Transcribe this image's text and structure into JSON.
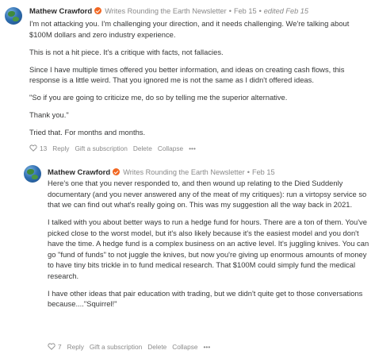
{
  "comments": [
    {
      "author": "Mathew Crawford",
      "badge_icon": "check-badge-icon",
      "publication": "Writes Rounding the Earth Newsletter",
      "date": "Feb 15",
      "edited": "edited Feb 15",
      "paragraphs": [
        "I'm not attacking you. I'm challenging your direction, and it needs challenging. We're talking about $100M dollars and zero industry experience.",
        "This is not a hit piece. It's a critique with facts, not fallacies.",
        "Since I have multiple times offered you better information, and ideas on creating cash flows, this response is a little weird. That you ignored me is not the same as I didn't offered ideas.",
        "\"So if you are going to criticize me, do so by telling me the superior alternative.",
        "Thank you.\"",
        "Tried that. For months and months."
      ],
      "actions": {
        "like_icon": "heart-icon",
        "likes": "13",
        "reply": "Reply",
        "gift": "Gift a subscription",
        "delete": "Delete",
        "collapse": "Collapse",
        "more": "•••"
      }
    },
    {
      "author": "Mathew Crawford",
      "badge_icon": "check-badge-icon",
      "publication": "Writes Rounding the Earth Newsletter",
      "date": "Feb 15",
      "paragraphs": [
        "Here's one that you never responded to, and then wound up relating to the Died Suddenly documentary (and you never answered any of the meat of my critiques): run a virtopsy service so that we can find out what's really going on. This was my suggestion all the way back in 2021.",
        "I talked with you about better ways to run a hedge fund for hours. There are a ton of them. You've picked close to the worst model, but it's also likely because it's the easiest model and you don't have the time. A hedge fund is a complex business on an active level. It's juggling knives. You can go \"fund of funds\" to not juggle the knives, but now you're giving up enormous amounts of money to have tiny bits trickle in to fund medical research. That $100M could simply fund the medical research.",
        "I have other ideas that pair education with trading, but we didn't quite get to those conversations because....\"Squirrel!\""
      ],
      "actions": {
        "like_icon": "heart-icon",
        "likes": "7",
        "reply": "Reply",
        "gift": "Gift a subscription",
        "delete": "Delete",
        "collapse": "Collapse",
        "more": "•••"
      }
    }
  ],
  "colors": {
    "text": "#363737",
    "meta": "#8a8a8a",
    "badge": "#f26722",
    "author": "#2b2b2b"
  }
}
